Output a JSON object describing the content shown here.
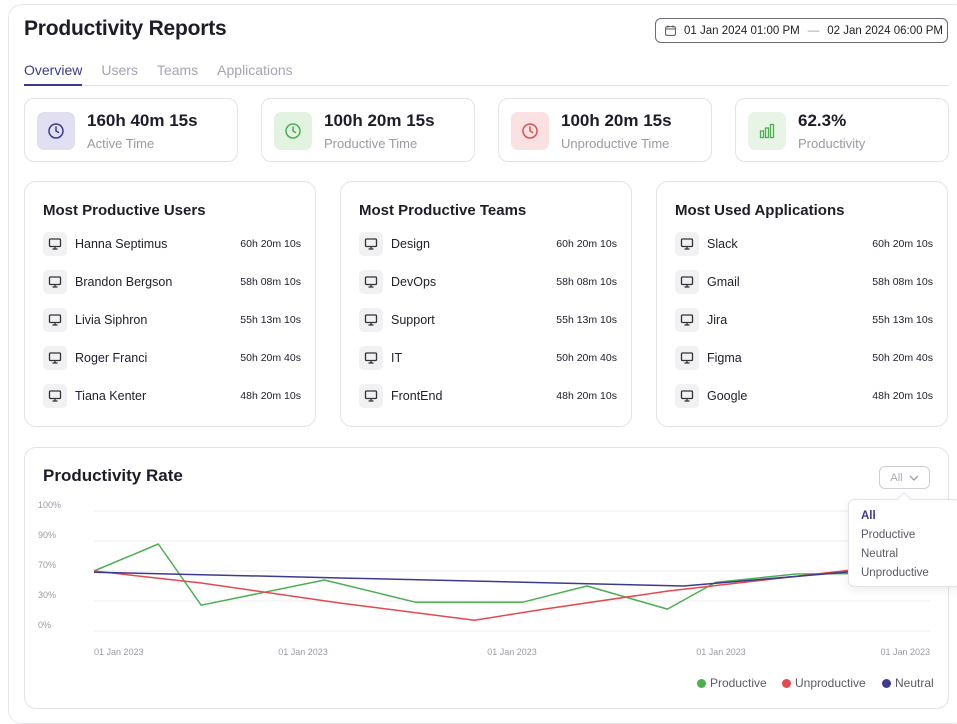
{
  "header": {
    "title": "Productivity Reports",
    "date_start": "01 Jan 2024 01:00 PM",
    "date_separator": "—",
    "date_end": "02 Jan 2024 06:00 PM"
  },
  "tabs": [
    {
      "label": "Overview",
      "active": true
    },
    {
      "label": "Users",
      "active": false
    },
    {
      "label": "Teams",
      "active": false
    },
    {
      "label": "Applications",
      "active": false
    }
  ],
  "stats": [
    {
      "value": "160h 40m 15s",
      "label": "Active Time",
      "icon": "clock-icon",
      "bg": "#e1e0f3",
      "color": "#3c3a8c"
    },
    {
      "value": "100h 20m 15s",
      "label": "Productive Time",
      "icon": "clock-icon",
      "bg": "#e3f3e1",
      "color": "#4caf50"
    },
    {
      "value": "100h 20m 15s",
      "label": "Unproductive Time",
      "icon": "clock-icon",
      "bg": "#fbe1e1",
      "color": "#d9534f"
    },
    {
      "value": "62.3%",
      "label": "Productivity",
      "icon": "bar-chart-icon",
      "bg": "#e8f5e6",
      "color": "#4caf50"
    }
  ],
  "cards": [
    {
      "title": "Most Productive Users",
      "rows": [
        {
          "name": "Hanna Septimus",
          "time": "60h 20m 10s"
        },
        {
          "name": "Brandon Bergson",
          "time": "58h 08m 10s"
        },
        {
          "name": "Livia Siphron",
          "time": "55h 13m 10s"
        },
        {
          "name": "Roger Franci",
          "time": "50h 20m 40s"
        },
        {
          "name": "Tiana Kenter",
          "time": "48h 20m 10s"
        }
      ]
    },
    {
      "title": "Most Productive Teams",
      "rows": [
        {
          "name": "Design",
          "time": "60h 20m 10s"
        },
        {
          "name": "DevOps",
          "time": "58h 08m 10s"
        },
        {
          "name": "Support",
          "time": "55h 13m 10s"
        },
        {
          "name": "IT",
          "time": "50h 20m 40s"
        },
        {
          "name": "FrontEnd",
          "time": "48h 20m 10s"
        }
      ]
    },
    {
      "title": "Most Used Applications",
      "rows": [
        {
          "name": "Slack",
          "time": "60h 20m 10s"
        },
        {
          "name": "Gmail",
          "time": "58h 08m 10s"
        },
        {
          "name": "Jira",
          "time": "55h 13m 10s"
        },
        {
          "name": "Figma",
          "time": "50h 20m 40s"
        },
        {
          "name": "Google",
          "time": "48h 20m 10s"
        }
      ]
    }
  ],
  "rate": {
    "title": "Productivity Rate",
    "filter_value": "All",
    "filter_options": [
      "All",
      "Productive",
      "Neutral",
      "Unproductive"
    ]
  },
  "chart_data": {
    "type": "line",
    "title": "Productivity Rate",
    "y_tick_labels": [
      "100%",
      "90%",
      "70%",
      "30%",
      "0%"
    ],
    "x_tick_labels": [
      "01 Jan 2023",
      "01 Jan 2023",
      "01 Jan 2023",
      "01 Jan 2023",
      "01 Jan 2023"
    ],
    "grid": true,
    "legend_position": "bottom-right",
    "series": [
      {
        "name": "Productive",
        "color": "#4caf50",
        "values": [
          [
            0,
            2
          ],
          [
            0.0769,
            2.9
          ],
          [
            0.1282,
            0.86
          ],
          [
            0.2756,
            1.7
          ],
          [
            0.3846,
            0.96
          ],
          [
            0.5128,
            0.96
          ],
          [
            0.5897,
            1.5
          ],
          [
            0.6859,
            0.73
          ],
          [
            0.7436,
            1.62
          ],
          [
            0.8397,
            1.9
          ],
          [
            1,
            1.93
          ]
        ]
      },
      {
        "name": "Unproductive",
        "color": "#e5484d",
        "values": [
          [
            0,
            2
          ],
          [
            0.1282,
            1.6
          ],
          [
            0.2949,
            0.93
          ],
          [
            0.4551,
            0.36
          ],
          [
            0.5385,
            0.73
          ],
          [
            0.6859,
            1.33
          ],
          [
            1,
            2.33
          ]
        ]
      },
      {
        "name": "Neutral",
        "color": "#3d3b8e",
        "values": [
          [
            0,
            1.96
          ],
          [
            0.3077,
            1.76
          ],
          [
            0.7051,
            1.5
          ],
          [
            1,
            2.2
          ]
        ]
      }
    ]
  },
  "legend": [
    {
      "name": "Productive",
      "color": "#4caf50"
    },
    {
      "name": "Unproductive",
      "color": "#e5484d"
    },
    {
      "name": "Neutral",
      "color": "#3d3b8e"
    }
  ]
}
